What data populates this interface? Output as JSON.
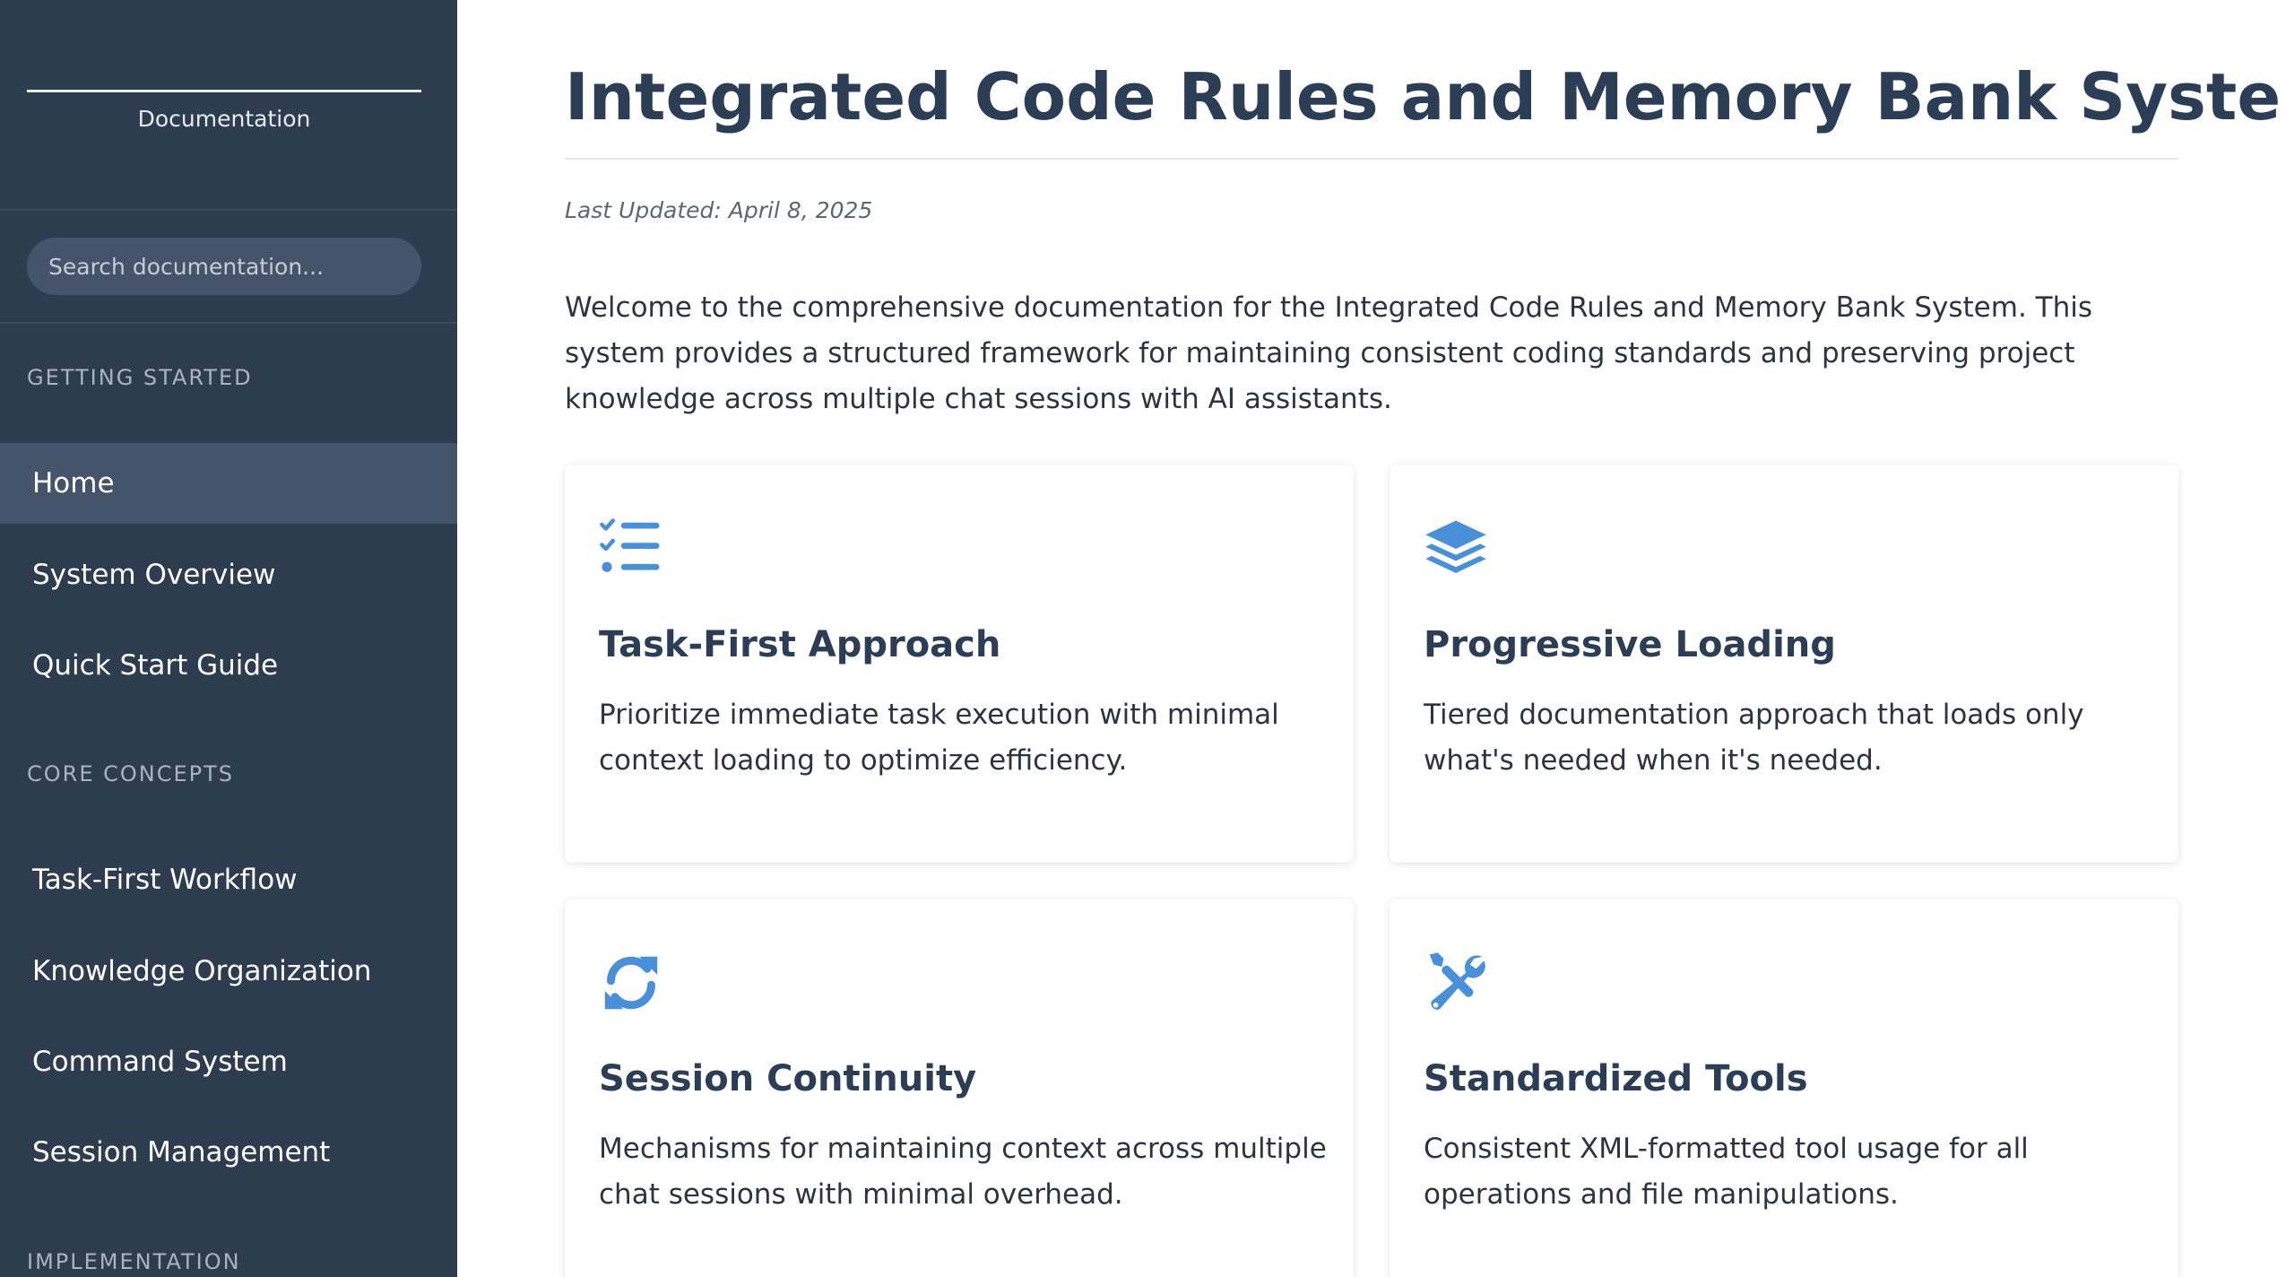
{
  "sidebar": {
    "subtitle": "Documentation",
    "search": {
      "placeholder": "Search documentation...",
      "value": ""
    },
    "sections": [
      {
        "label": "GETTING STARTED",
        "items": [
          {
            "label": "Home",
            "active": true
          },
          {
            "label": "System Overview"
          },
          {
            "label": "Quick Start Guide"
          }
        ]
      },
      {
        "label": "CORE CONCEPTS",
        "items": [
          {
            "label": "Task-First Workflow"
          },
          {
            "label": "Knowledge Organization"
          },
          {
            "label": "Command System"
          },
          {
            "label": "Session Management"
          }
        ]
      },
      {
        "label": "IMPLEMENTATION",
        "items": []
      }
    ]
  },
  "main": {
    "title": "Integrated Code Rules and Memory Bank System",
    "last_updated": "Last Updated: April 8, 2025",
    "intro": "Welcome to the comprehensive documentation for the Integrated Code Rules and Memory Bank System. This system provides a structured framework for maintaining consistent coding standards and preserving project knowledge across multiple chat sessions with AI assistants.",
    "cards": [
      {
        "icon": "task-list-icon",
        "title": "Task-First Approach",
        "description": "Prioritize immediate task execution with minimal context loading to optimize efficiency."
      },
      {
        "icon": "layers-icon",
        "title": "Progressive Loading",
        "description": "Tiered documentation approach that loads only what's needed when it's needed."
      },
      {
        "icon": "sync-icon",
        "title": "Session Continuity",
        "description": "Mechanisms for maintaining context across multiple chat sessions with minimal overhead."
      },
      {
        "icon": "tools-icon",
        "title": "Standardized Tools",
        "description": "Consistent XML-formatted tool usage for all operations and file manipulations."
      }
    ]
  },
  "colors": {
    "sidebar_bg": "#2e3c4f",
    "sidebar_active": "#45546a",
    "heading": "#2c3e55",
    "icon_accent": "#4a90d9",
    "body_text": "#2d3440"
  }
}
